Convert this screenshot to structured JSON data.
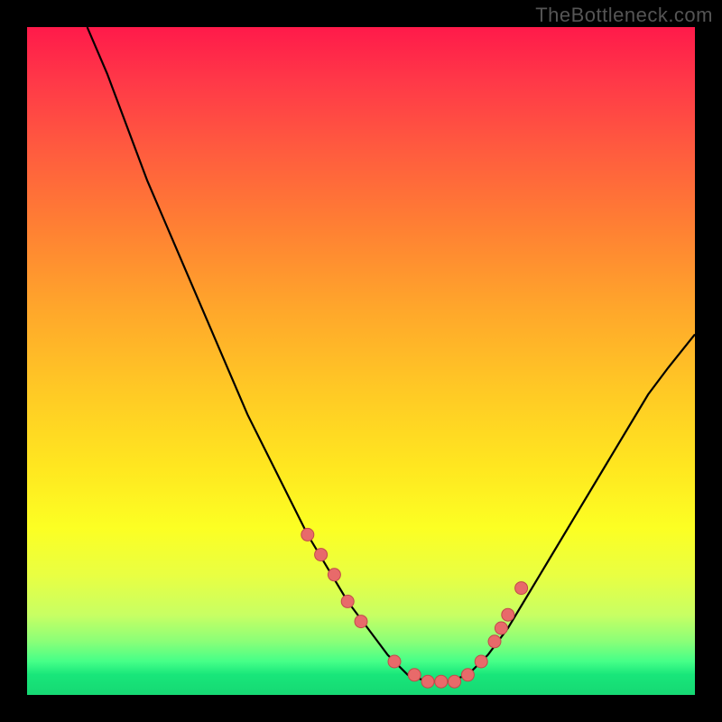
{
  "watermark": "TheBottleneck.com",
  "colors": {
    "background": "#000000",
    "curve_stroke": "#000000",
    "point_fill": "#e86a6a",
    "point_stroke": "#c24a4a",
    "gradient_top": "#ff1a4a",
    "gradient_bottom": "#16d873"
  },
  "chart_data": {
    "type": "line",
    "title": "",
    "xlabel": "",
    "ylabel": "",
    "xlim": [
      0,
      100
    ],
    "ylim": [
      0,
      100
    ],
    "curve": {
      "description": "U-shaped bottleneck curve with minimum near x≈60, left arm reaching y≈100 at x≈9, right arm reaching y≈54 at x=100",
      "x": [
        9,
        12,
        15,
        18,
        21,
        24,
        27,
        30,
        33,
        36,
        39,
        42,
        45,
        48,
        51,
        54,
        57,
        60,
        63,
        66,
        69,
        72,
        75,
        78,
        81,
        84,
        87,
        90,
        93,
        96,
        100
      ],
      "y": [
        100,
        93,
        85,
        77,
        70,
        63,
        56,
        49,
        42,
        36,
        30,
        24,
        19,
        14,
        10,
        6,
        3,
        2,
        2,
        3,
        6,
        10,
        15,
        20,
        25,
        30,
        35,
        40,
        45,
        49,
        54
      ]
    },
    "series": [
      {
        "name": "marked-points",
        "x": [
          42,
          44,
          46,
          48,
          50,
          55,
          58,
          60,
          62,
          64,
          66,
          68,
          70,
          71,
          72,
          74
        ],
        "y": [
          24,
          21,
          18,
          14,
          11,
          5,
          3,
          2,
          2,
          2,
          3,
          5,
          8,
          10,
          12,
          16
        ]
      }
    ]
  }
}
